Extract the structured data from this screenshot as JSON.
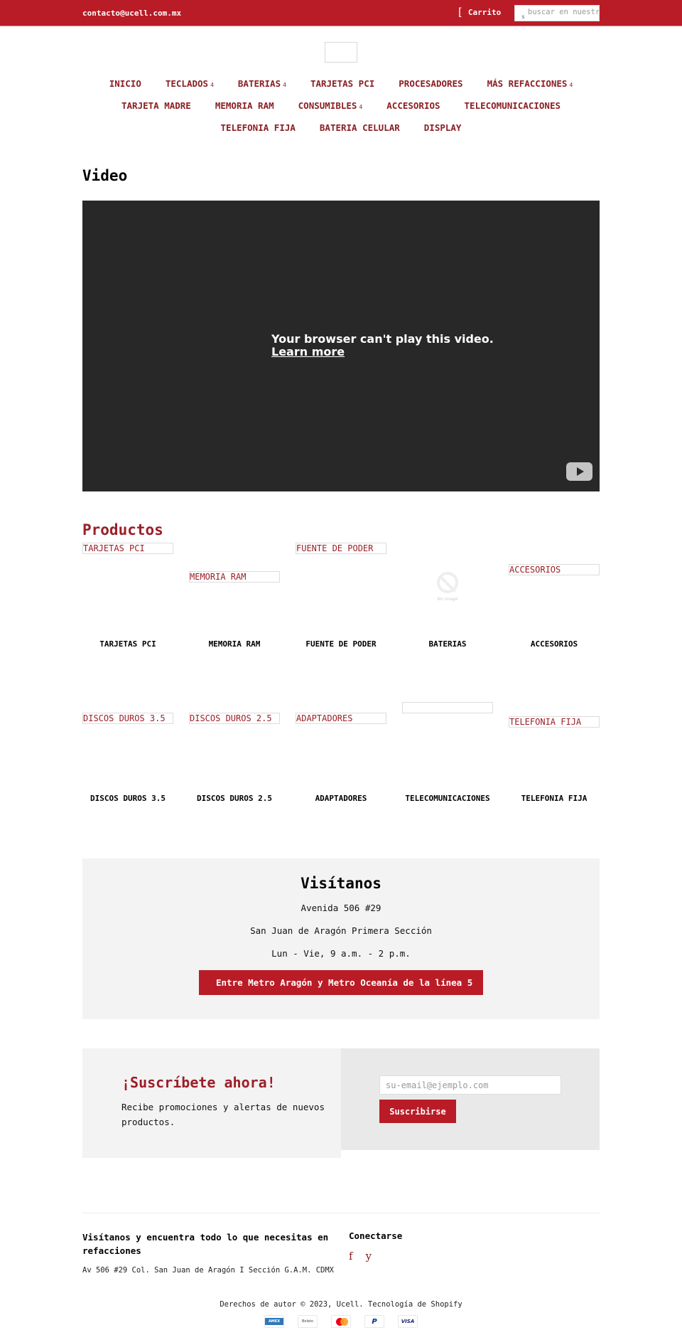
{
  "topbar": {
    "email": "contacto@ucell.com.mx",
    "cart_icon": "[",
    "cart_label": "Carrito",
    "search_icon": "s",
    "search_placeholder": "buscar en nuestra tienda"
  },
  "nav": {
    "rows": [
      [
        {
          "label": "INICIO",
          "dropdown": false
        },
        {
          "label": "TECLADOS",
          "dropdown": true
        },
        {
          "label": "BATERIAS",
          "dropdown": true
        },
        {
          "label": "TARJETAS PCI",
          "dropdown": false
        },
        {
          "label": "PROCESADORES",
          "dropdown": false
        },
        {
          "label": "MÁS REFACCIONES",
          "dropdown": true
        }
      ],
      [
        {
          "label": "TARJETA MADRE",
          "dropdown": false
        },
        {
          "label": "MEMORIA RAM",
          "dropdown": false
        },
        {
          "label": "CONSUMIBLES",
          "dropdown": true
        },
        {
          "label": "ACCESORIOS",
          "dropdown": false
        },
        {
          "label": "TELECOMUNICACIONES",
          "dropdown": false
        }
      ],
      [
        {
          "label": "TELEFONIA FIJA",
          "dropdown": false
        },
        {
          "label": "BATERIA CELULAR",
          "dropdown": false
        },
        {
          "label": "DISPLAY",
          "dropdown": false
        }
      ]
    ],
    "caret_glyph": "4"
  },
  "video": {
    "title": "Video",
    "message": "Your browser can't play this video.",
    "learn_more": "Learn more"
  },
  "products": {
    "title": "Productos",
    "no_image_text": "No image",
    "items": [
      {
        "title": "TARJETAS PCI",
        "image_alt": "TARJETAS PCI"
      },
      {
        "title": "MEMORIA RAM",
        "image_alt": "MEMORIA RAM"
      },
      {
        "title": "FUENTE DE PODER",
        "image_alt": "FUENTE DE PODER"
      },
      {
        "title": "BATERIAS",
        "image_alt": null
      },
      {
        "title": "ACCESORIOS",
        "image_alt": "ACCESORIOS"
      },
      {
        "title": "DISCOS DUROS 3.5",
        "image_alt": "DISCOS DUROS 3.5"
      },
      {
        "title": "DISCOS DUROS 2.5",
        "image_alt": "DISCOS DUROS 2.5"
      },
      {
        "title": "ADAPTADORES",
        "image_alt": "ADAPTADORES"
      },
      {
        "title": "TELECOMUNICACIONES",
        "image_alt": ""
      },
      {
        "title": "TELEFONIA FIJA",
        "image_alt": "TELEFONIA FIJA"
      }
    ]
  },
  "visit": {
    "title": "Visítanos",
    "address": "Avenida 506 #29",
    "neighborhood": "San Juan de Aragón Primera Sección",
    "hours": "Lun - Vie, 9 a.m. - 2 p.m.",
    "button": "Entre Metro Aragón y Metro Oceanía de la línea 5"
  },
  "subscribe": {
    "title": "¡Suscríbete ahora!",
    "text": "Recibe promociones y alertas de nuevos productos.",
    "email_placeholder": "su-email@ejemplo.com",
    "button": "Suscribirse"
  },
  "footer": {
    "col1_title": "Visítanos y encuentra todo lo que necesitas en refacciones",
    "col1_text": "Av 506 #29 Col. San Juan de Aragón I Sección G.A.M. CDMX",
    "col2_title": "Conectarse",
    "social": [
      {
        "name": "facebook",
        "glyph": "f"
      },
      {
        "name": "youtube",
        "glyph": "y"
      }
    ],
    "copyright": "Derechos de autor © 2023, Ucell. Tecnología de Shopify",
    "payments": [
      {
        "name": "amex",
        "label": "AMEX"
      },
      {
        "name": "boleto",
        "label": "Boleto"
      },
      {
        "name": "mastercard",
        "label": ""
      },
      {
        "name": "paypal",
        "label": "P"
      },
      {
        "name": "visa",
        "label": "VISA"
      }
    ]
  },
  "colors": {
    "brand_red": "#b91c26",
    "link_red": "#9b1f27",
    "video_bg": "#282828",
    "panel_gray": "#f3f3f3"
  }
}
